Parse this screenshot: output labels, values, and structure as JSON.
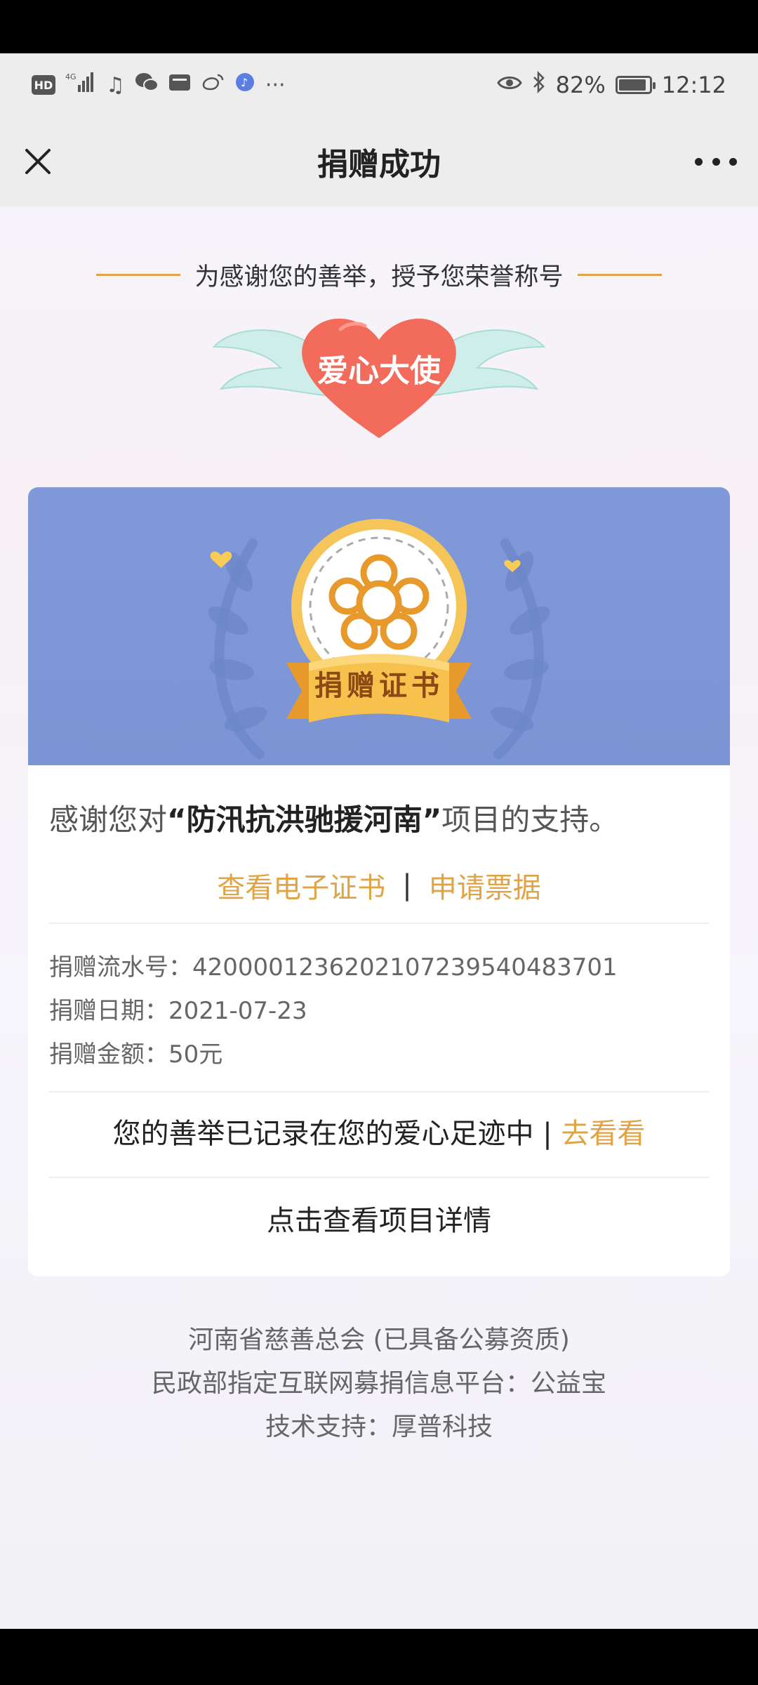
{
  "status_bar": {
    "left_icons": [
      "hd-icon",
      "signal-4g-icon",
      "music-icon",
      "wechat-icon",
      "mail-icon",
      "weibo-icon",
      "music-note-icon",
      "more-dots-icon"
    ],
    "battery": "82%",
    "time": "12:12"
  },
  "nav": {
    "title": "捐赠成功"
  },
  "honor": {
    "caption": "为感谢您的善举，授予您荣誉称号",
    "title_badge": "爱心大使"
  },
  "certificate": {
    "ribbon_label": "捐赠证书"
  },
  "thanks": {
    "prefix": "感谢您对",
    "project": "“防汛抗洪驰援河南”",
    "suffix": "项目的支持。"
  },
  "links": {
    "view_certificate": "查看电子证书",
    "separator": "|",
    "apply_receipt": "申请票据"
  },
  "donation": {
    "serial_label": "捐赠流水号：",
    "serial_value": "420000123620210723954048370​1",
    "date_label": "捐赠日期：",
    "date_value": "2021-07-23",
    "amount_label": "捐赠金额：",
    "amount_value": "50元"
  },
  "footprint": {
    "text": "您的善举已记录在您的爱心足迹中 | ",
    "link": "去看看"
  },
  "project_detail": "点击查看项目详情",
  "footer": {
    "line1": "河南省慈善总会 (已具备公募资质)",
    "line2": "民政部指定互联网募捐信息平台：公益宝",
    "line3": "技术支持：厚普科技"
  },
  "colors": {
    "accent": "#e0a447",
    "banner": "#7f99d9",
    "heart": "#f26b5b"
  }
}
